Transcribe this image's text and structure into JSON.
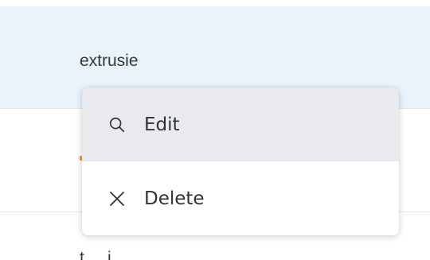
{
  "rows": [
    {
      "label": "extrusie",
      "selected": true
    },
    {
      "label": "t ... i",
      "selected": false
    }
  ],
  "context_menu": {
    "items": [
      {
        "label": "Edit",
        "icon": "search-icon",
        "hovered": true
      },
      {
        "label": "Delete",
        "icon": "close-icon",
        "hovered": false
      }
    ]
  },
  "colors": {
    "selected_row_bg": "#e8f3fc",
    "menu_hover_bg": "#e8eaed",
    "text": "#333840",
    "divider": "#e3e6ea"
  }
}
